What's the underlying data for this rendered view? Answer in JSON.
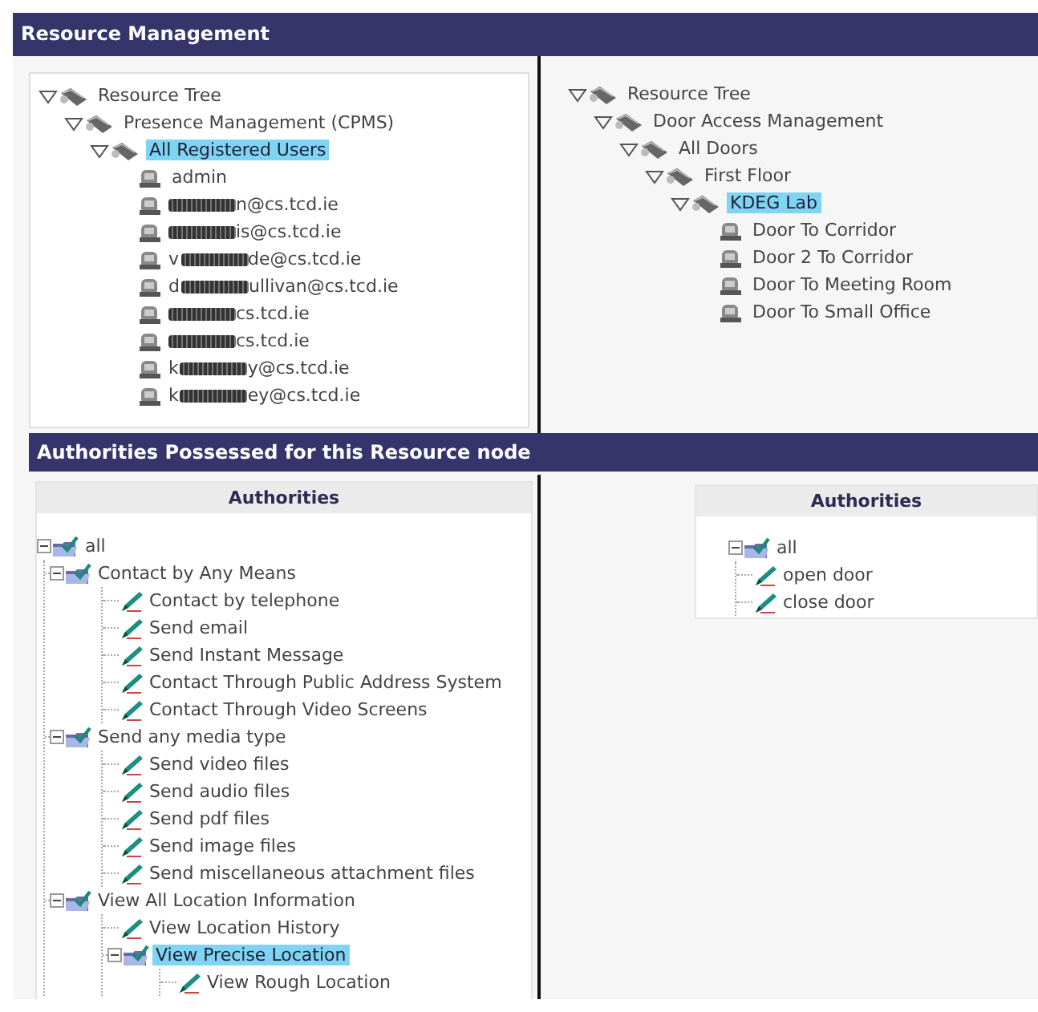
{
  "header": {
    "title": "Resource Management"
  },
  "resource_trees": [
    {
      "nodes": [
        {
          "kind": "group",
          "label": "Resource Tree",
          "expanded": true,
          "selected": false,
          "children": [
            {
              "kind": "group",
              "label": "Presence Management (CPMS)",
              "expanded": true,
              "selected": false,
              "children": [
                {
                  "kind": "group",
                  "label": "All Registered Users",
                  "expanded": true,
                  "selected": true,
                  "children": [
                    {
                      "kind": "leaf",
                      "label": "admin",
                      "selected": false
                    },
                    {
                      "kind": "leaf",
                      "redacted": true,
                      "label": "n@cs.tcd.ie",
                      "selected": false
                    },
                    {
                      "kind": "leaf",
                      "redacted": true,
                      "label": "is@cs.tcd.ie",
                      "selected": false
                    },
                    {
                      "kind": "leaf",
                      "redacted": true,
                      "prefix": "v",
                      "label": "de@cs.tcd.ie",
                      "selected": false
                    },
                    {
                      "kind": "leaf",
                      "redacted": true,
                      "prefix": "d",
                      "label": "ullivan@cs.tcd.ie",
                      "selected": false
                    },
                    {
                      "kind": "leaf",
                      "redacted": true,
                      "label": "cs.tcd.ie",
                      "selected": false
                    },
                    {
                      "kind": "leaf",
                      "redacted": true,
                      "label": "cs.tcd.ie",
                      "selected": false
                    },
                    {
                      "kind": "leaf",
                      "redacted": true,
                      "prefix": "k",
                      "label": "y@cs.tcd.ie",
                      "selected": false
                    },
                    {
                      "kind": "leaf",
                      "redacted": true,
                      "prefix": "k",
                      "label": "ey@cs.tcd.ie",
                      "selected": false
                    }
                  ]
                }
              ]
            }
          ]
        }
      ]
    },
    {
      "nodes": [
        {
          "kind": "group",
          "label": "Resource Tree",
          "expanded": true,
          "selected": false,
          "children": [
            {
              "kind": "group",
              "label": "Door Access Management",
              "expanded": true,
              "selected": false,
              "children": [
                {
                  "kind": "group",
                  "label": "All Doors",
                  "expanded": true,
                  "selected": false,
                  "children": [
                    {
                      "kind": "group",
                      "label": "First Floor",
                      "expanded": true,
                      "selected": false,
                      "children": [
                        {
                          "kind": "group",
                          "label": "KDEG Lab",
                          "expanded": true,
                          "selected": true,
                          "children": [
                            {
                              "kind": "leaf",
                              "label": "Door To Corridor",
                              "selected": false
                            },
                            {
                              "kind": "leaf",
                              "label": "Door 2 To Corridor",
                              "selected": false
                            },
                            {
                              "kind": "leaf",
                              "label": "Door To Meeting Room",
                              "selected": false
                            },
                            {
                              "kind": "leaf",
                              "label": "Door To Small Office",
                              "selected": false
                            }
                          ]
                        }
                      ]
                    }
                  ]
                }
              ]
            }
          ]
        }
      ]
    }
  ],
  "authorities_section": {
    "title": "Authorities Possessed for this Resource node"
  },
  "authority_tables": [
    {
      "column": "Authorities",
      "nodes": [
        {
          "kind": "category",
          "label": "all",
          "expanded": true,
          "selected": false,
          "children": [
            {
              "kind": "category",
              "label": "Contact by Any Means",
              "expanded": true,
              "selected": false,
              "children": [
                {
                  "kind": "permission",
                  "label": "Contact by telephone",
                  "selected": false
                },
                {
                  "kind": "permission",
                  "label": "Send email",
                  "selected": false
                },
                {
                  "kind": "permission",
                  "label": "Send Instant Message",
                  "selected": false
                },
                {
                  "kind": "permission",
                  "label": "Contact Through Public Address System",
                  "selected": false
                },
                {
                  "kind": "permission",
                  "label": "Contact Through Video Screens",
                  "selected": false
                }
              ]
            },
            {
              "kind": "category",
              "label": "Send any media type",
              "expanded": true,
              "selected": false,
              "children": [
                {
                  "kind": "permission",
                  "label": "Send video files",
                  "selected": false
                },
                {
                  "kind": "permission",
                  "label": "Send audio files",
                  "selected": false
                },
                {
                  "kind": "permission",
                  "label": "Send pdf files",
                  "selected": false
                },
                {
                  "kind": "permission",
                  "label": "Send image files",
                  "selected": false
                },
                {
                  "kind": "permission",
                  "label": "Send miscellaneous attachment files",
                  "selected": false
                }
              ]
            },
            {
              "kind": "category",
              "label": "View All Location Information",
              "expanded": true,
              "selected": false,
              "children": [
                {
                  "kind": "permission",
                  "label": "View Location History",
                  "selected": false
                },
                {
                  "kind": "category",
                  "label": "View Precise Location",
                  "expanded": true,
                  "selected": true,
                  "children": [
                    {
                      "kind": "permission",
                      "label": "View Rough Location",
                      "selected": false
                    }
                  ]
                }
              ]
            }
          ]
        }
      ]
    },
    {
      "column": "Authorities",
      "nodes": [
        {
          "kind": "category",
          "label": "all",
          "expanded": true,
          "selected": false,
          "children": [
            {
              "kind": "permission",
              "label": "open door",
              "selected": false
            },
            {
              "kind": "permission",
              "label": "close door",
              "selected": false
            }
          ]
        }
      ]
    }
  ]
}
